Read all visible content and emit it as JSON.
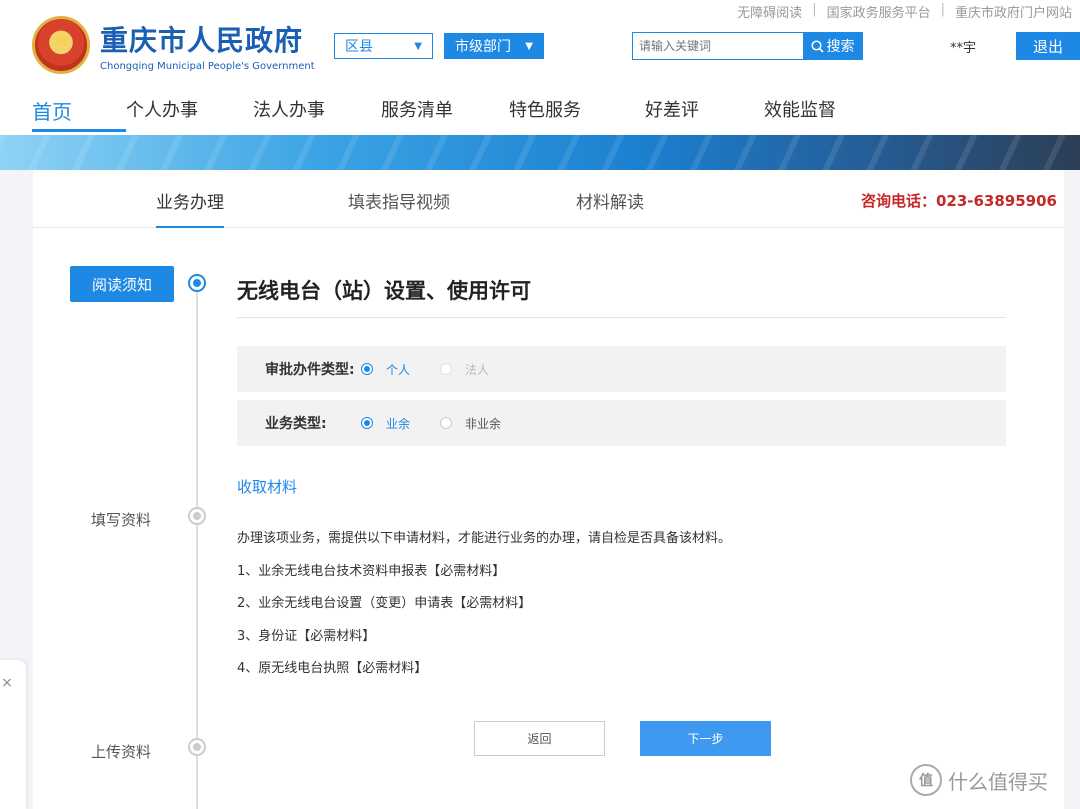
{
  "top_links": [
    "无障碍阅读",
    "国家政务服务平台",
    "重庆市政府门户网站"
  ],
  "top_link_separator": "|",
  "logo": {
    "cn": "重庆市人民政府",
    "en": "Chongqing Municipal People's Government"
  },
  "selects": {
    "district": "区县",
    "department": "市级部门"
  },
  "search": {
    "placeholder": "请输入关键词",
    "button": "搜索"
  },
  "user": {
    "name": "**宇",
    "logout": "退出"
  },
  "main_nav": [
    "首页",
    "个人办事",
    "法人办事",
    "服务清单",
    "特色服务",
    "好差评",
    "效能监督"
  ],
  "sub_tabs": [
    "业务办理",
    "填表指导视频",
    "材料解读"
  ],
  "hotline": {
    "label": "咨询电话：",
    "number": "023-63895906"
  },
  "steps": [
    "阅读须知",
    "填写资料",
    "上传资料"
  ],
  "title": "无线电台（站）设置、使用许可",
  "approval_type": {
    "label": "审批办件类型:",
    "options": [
      "个人",
      "法人"
    ],
    "selected": "个人"
  },
  "business_type": {
    "label": "业务类型:",
    "options": [
      "业余",
      "非业余"
    ],
    "selected": "业余"
  },
  "materials": {
    "heading": "收取材料",
    "description": "办理该项业务，需提供以下申请材料，才能进行业务的办理，请自检是否具备该材料。",
    "items": [
      "1、业余无线电台技术资料申报表【必需材料】",
      "2、业余无线电台设置（变更）申请表【必需材料】",
      "3、身份证【必需材料】",
      "4、原无线电台执照【必需材料】"
    ]
  },
  "buttons": {
    "back": "返回",
    "next": "下一步"
  },
  "close_symbol": "×",
  "watermark": {
    "badge": "值",
    "text": "什么值得买"
  },
  "colors": {
    "accent": "#1e88e5",
    "hotline": "#c62828",
    "next_button": "#3d9af0"
  }
}
